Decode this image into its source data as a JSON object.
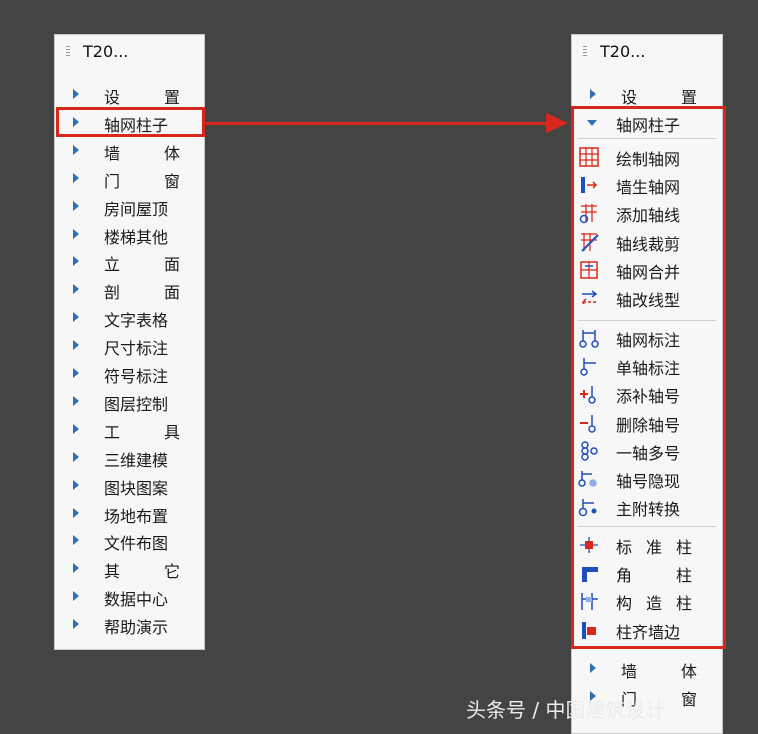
{
  "left_panel": {
    "title": "T20...",
    "items": [
      {
        "parts": [
          "设",
          "置"
        ]
      },
      {
        "parts": [
          "轴网柱子"
        ]
      },
      {
        "parts": [
          "墙",
          "体"
        ]
      },
      {
        "parts": [
          "门",
          "窗"
        ]
      },
      {
        "parts": [
          "房间屋顶"
        ]
      },
      {
        "parts": [
          "楼梯其他"
        ]
      },
      {
        "parts": [
          "立",
          "面"
        ]
      },
      {
        "parts": [
          "剖",
          "面"
        ]
      },
      {
        "parts": [
          "文字表格"
        ]
      },
      {
        "parts": [
          "尺寸标注"
        ]
      },
      {
        "parts": [
          "符号标注"
        ]
      },
      {
        "parts": [
          "图层控制"
        ]
      },
      {
        "parts": [
          "工",
          "具"
        ]
      },
      {
        "parts": [
          "三维建模"
        ]
      },
      {
        "parts": [
          "图块图案"
        ]
      },
      {
        "parts": [
          "场地布置"
        ]
      },
      {
        "parts": [
          "文件布图"
        ]
      },
      {
        "parts": [
          "其",
          "它"
        ]
      },
      {
        "parts": [
          "数据中心"
        ]
      },
      {
        "parts": [
          "帮助演示"
        ]
      }
    ]
  },
  "right_panel": {
    "title": "T20...",
    "top_item": {
      "parts": [
        "设",
        "置"
      ]
    },
    "expanded_item": {
      "parts": [
        "轴网柱子"
      ]
    },
    "groups": [
      [
        {
          "parts": [
            "绘制轴网"
          ],
          "icon": "grid-icon"
        },
        {
          "parts": [
            "墙生轴网"
          ],
          "icon": "wall-grid-icon"
        },
        {
          "parts": [
            "添加轴线"
          ],
          "icon": "add-axis-icon"
        },
        {
          "parts": [
            "轴线裁剪"
          ],
          "icon": "axis-trim-icon"
        },
        {
          "parts": [
            "轴网合并"
          ],
          "icon": "grid-merge-icon"
        },
        {
          "parts": [
            "轴改线型"
          ],
          "icon": "axis-linetype-icon"
        }
      ],
      [
        {
          "parts": [
            "轴网标注"
          ],
          "icon": "grid-dimension-icon"
        },
        {
          "parts": [
            "单轴标注"
          ],
          "icon": "single-axis-dimension-icon"
        },
        {
          "parts": [
            "添补轴号"
          ],
          "icon": "add-axis-number-icon"
        },
        {
          "parts": [
            "删除轴号"
          ],
          "icon": "delete-axis-number-icon"
        },
        {
          "parts": [
            "一轴多号"
          ],
          "icon": "multi-number-icon"
        },
        {
          "parts": [
            "轴号隐现"
          ],
          "icon": "axis-number-visibility-icon"
        },
        {
          "parts": [
            "主附转换"
          ],
          "icon": "main-sub-switch-icon"
        }
      ],
      [
        {
          "parts": [
            "标",
            "准",
            "柱"
          ],
          "icon": "standard-column-icon"
        },
        {
          "parts": [
            "角",
            "柱"
          ],
          "icon": "corner-column-icon"
        },
        {
          "parts": [
            "构",
            "造",
            "柱"
          ],
          "icon": "structural-column-icon"
        },
        {
          "parts": [
            "柱齐墙边"
          ],
          "icon": "column-align-wall-icon"
        }
      ]
    ],
    "after_items": [
      {
        "parts": [
          "墙",
          "体"
        ]
      },
      {
        "parts": [
          "门",
          "窗"
        ]
      }
    ]
  },
  "watermark": "头条号 / 中国建筑设计",
  "colors": {
    "background": "#444444",
    "panel": "#f7f7f7",
    "highlight": "#d8281d",
    "triangle": "#2f6fb5",
    "icon_blue": "#1f4fbf",
    "icon_red": "#d8281d"
  }
}
